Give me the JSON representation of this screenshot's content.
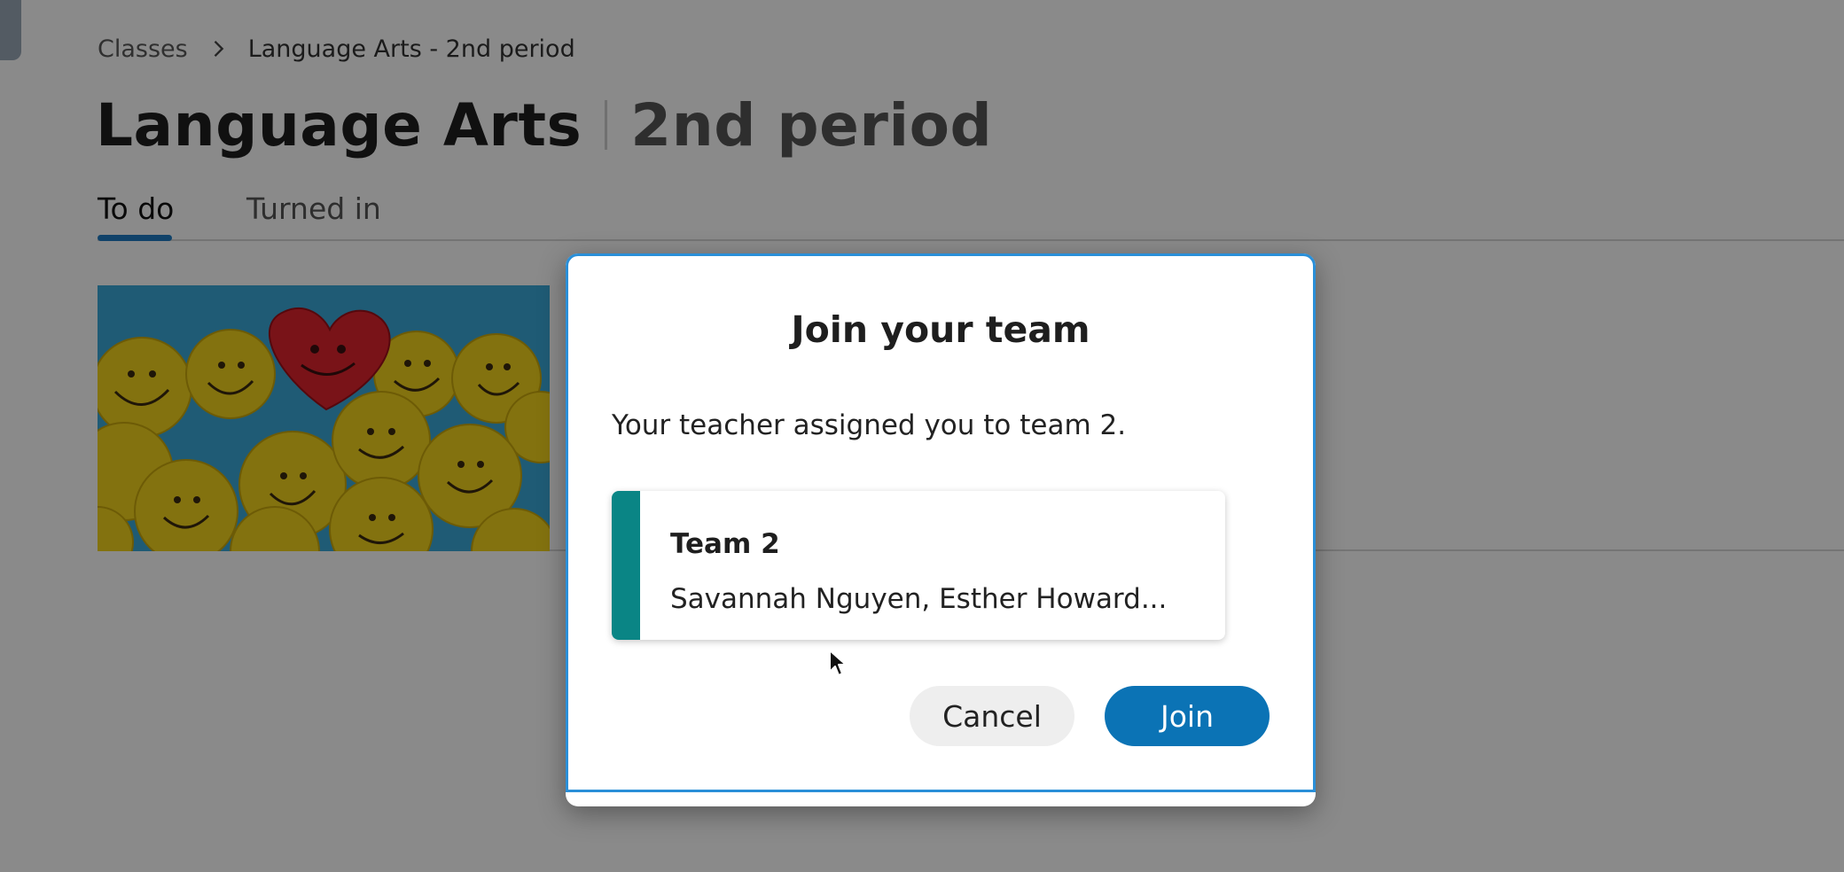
{
  "breadcrumb": {
    "root": "Classes",
    "current": "Language Arts - 2nd period"
  },
  "page": {
    "title": "Language Arts",
    "subtitle": "2nd period"
  },
  "tabs": [
    {
      "label": "To do",
      "active": true
    },
    {
      "label": "Turned in",
      "active": false
    }
  ],
  "dialog": {
    "title": "Join your team",
    "message": "Your teacher assigned you to team 2.",
    "team": {
      "name": "Team 2",
      "members": "Savannah Nguyen, Esther Howard...",
      "color": "#0a8585"
    },
    "cancel_label": "Cancel",
    "join_label": "Join"
  },
  "colors": {
    "accent": "#0b73b5",
    "tab_underline": "#1f7ac2",
    "focus_ring": "#2a8fd8"
  },
  "icons": {
    "breadcrumb_separator": "chevron-right-icon",
    "card_image": "smiley-balls-heart-image",
    "cursor": "mouse-pointer-icon"
  }
}
